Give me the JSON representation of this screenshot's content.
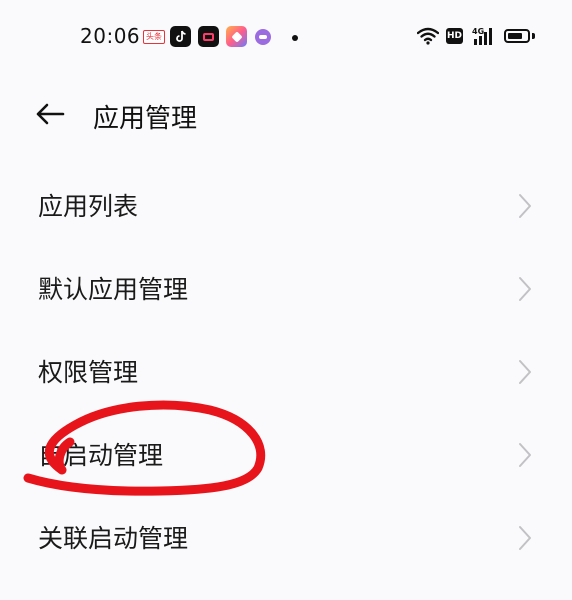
{
  "status_bar": {
    "time": "20:06",
    "notification_icons": [
      "toutiao-icon",
      "tiktok-icon",
      "video-app-icon",
      "browser-app-icon",
      "chat-app-icon"
    ],
    "toutiao_badge": "头条",
    "network_badge": "HD",
    "signal_label": "4G",
    "battery_level": 0.75
  },
  "header": {
    "title": "应用管理"
  },
  "menu": {
    "items": [
      {
        "label": "应用列表"
      },
      {
        "label": "默认应用管理"
      },
      {
        "label": "权限管理"
      },
      {
        "label": "自启动管理"
      },
      {
        "label": "关联启动管理"
      }
    ]
  },
  "annotation": {
    "color": "#e8141b",
    "circled_item": "自启动管理"
  },
  "colors": {
    "background": "#fafafc",
    "text": "#1a1a1a",
    "chevron": "#c2c2c6"
  }
}
